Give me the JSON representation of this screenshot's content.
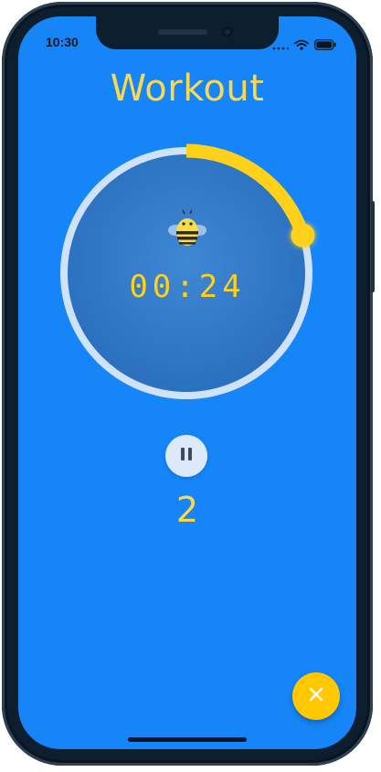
{
  "status_bar": {
    "time": "10:30"
  },
  "screen": {
    "title": "Workout",
    "timer": "00:24",
    "progress_fraction": 0.2,
    "rep_count": "2",
    "background_color": "#1685f8",
    "accent_color": "#ffd11a"
  },
  "icons": {
    "mascot": "bee-icon",
    "pause": "pause-icon",
    "close": "close-icon",
    "signal": "signal-icon",
    "wifi": "wifi-icon",
    "battery": "battery-icon"
  }
}
